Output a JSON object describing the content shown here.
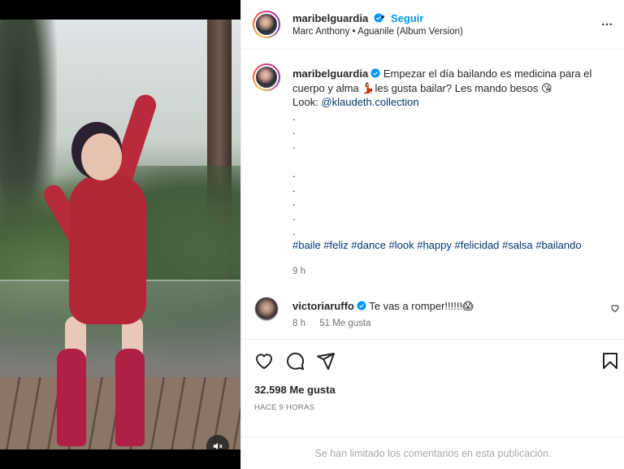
{
  "post": {
    "author": "maribelguardia",
    "follow_label": "Seguir",
    "separator": "•",
    "song": "Marc Anthony • Aguanile (Album Version)"
  },
  "caption": {
    "username": "maribelguardia",
    "text_1": "Empezar el día bailando es medicina para el cuerpo y alma 💃🏻les gusta bailar? Les mando besos 😘",
    "look_label": "Look: ",
    "look_link": "@klaudeth.collection",
    "dots": [
      ".",
      ".",
      ".",
      "",
      ".",
      ".",
      ".",
      ".",
      "."
    ],
    "hashtags": "#baile #feliz #dance #look #happy #felicidad #salsa #bailando",
    "time": "9 h"
  },
  "comment": {
    "username": "victoriaruffo",
    "text": "Te vas a romper!!!!!!😱",
    "time": "8 h",
    "likes": "51 Me gusta"
  },
  "stats": {
    "likes": "32.598 Me gusta",
    "time_ago": "HACE 9 HORAS"
  },
  "footer": {
    "notice": "Se han limitado los comentarios en esta publicación."
  },
  "icons": {
    "verified": "verified-badge-icon",
    "more": "more-options-icon",
    "heart": "heart-icon",
    "comment": "comment-icon",
    "share": "share-icon",
    "save": "bookmark-icon",
    "mute": "volume-muted-icon"
  },
  "colors": {
    "accent": "#0095f6",
    "link": "#00376b",
    "muted": "#737373"
  }
}
